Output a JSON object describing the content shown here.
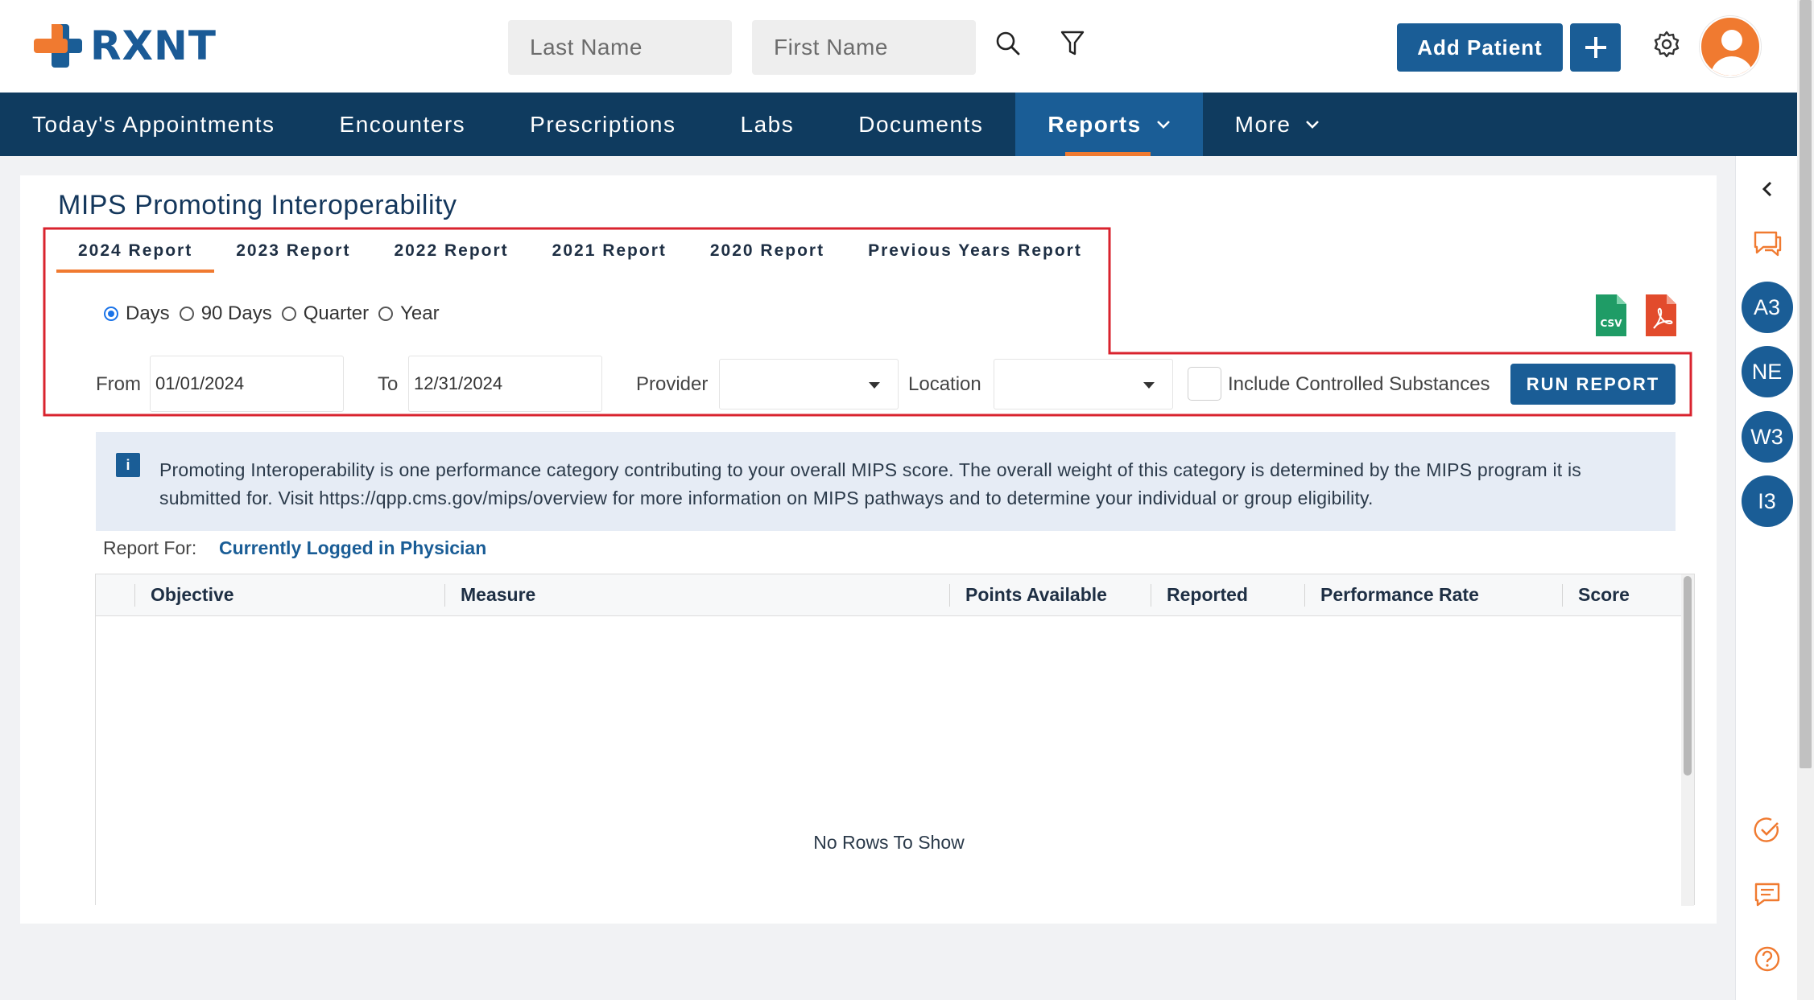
{
  "app": {
    "logo_text": "RXNT",
    "brand_color": "#1a5d96",
    "accent_color": "#f07a30",
    "nav_color": "#0f3b5f"
  },
  "header": {
    "last_name_placeholder": "Last Name",
    "first_name_placeholder": "First Name",
    "search_icon": "search-icon",
    "filter_icon": "filter-icon",
    "add_patient_label": "Add Patient",
    "settings_icon": "gear-icon"
  },
  "nav": {
    "items": [
      {
        "label": "Today's Appointments"
      },
      {
        "label": "Encounters"
      },
      {
        "label": "Prescriptions"
      },
      {
        "label": "Labs"
      },
      {
        "label": "Documents"
      },
      {
        "label": "Reports",
        "active": true,
        "dropdown": true
      },
      {
        "label": "More",
        "dropdown": true
      }
    ]
  },
  "page": {
    "title": "MIPS Promoting Interoperability",
    "tabs": [
      "2024 Report",
      "2023 Report",
      "2022 Report",
      "2021 Report",
      "2020 Report",
      "Previous Years Report"
    ],
    "active_tab": "2024 Report",
    "range_options": [
      "Days",
      "90 Days",
      "Quarter",
      "Year"
    ],
    "selected_range": "Days",
    "from_label": "From",
    "from_value": "01/01/2024",
    "to_label": "To",
    "to_value": "12/31/2024",
    "provider_label": "Provider",
    "provider_value": "",
    "location_label": "Location",
    "location_value": "",
    "include_controlled_label": "Include Controlled Substances",
    "include_controlled_checked": false,
    "run_report_label": "RUN REPORT",
    "csv_label": "CSV",
    "info_icon_glyph": "i",
    "info_text": "Promoting Interoperability is one performance category contributing to your overall MIPS score. The overall weight of this category is determined by the MIPS program it is submitted for. Visit https://qpp.cms.gov/mips/overview for more information on MIPS pathways and to determine your individual or group eligibility.",
    "report_for_label": "Report For:",
    "report_for_value": "Currently Logged in Physician"
  },
  "grid": {
    "columns": [
      "Objective",
      "Measure",
      "Points Available",
      "Reported",
      "Performance Rate",
      "Score"
    ],
    "rows": [],
    "empty_text": "No Rows To Show"
  },
  "rail": {
    "badges": [
      "A3",
      "NE",
      "W3",
      "I3"
    ]
  }
}
